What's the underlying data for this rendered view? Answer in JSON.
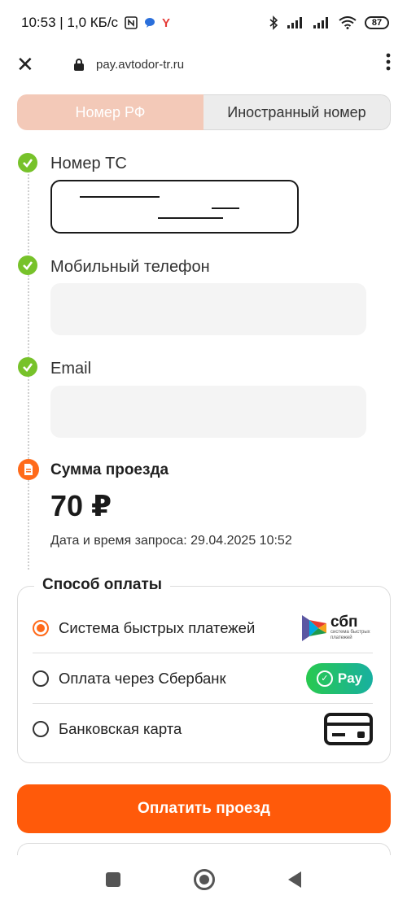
{
  "status_bar": {
    "time_speed": "10:53 | 1,0 КБ/с",
    "battery": "87"
  },
  "browser": {
    "url": "pay.avtodor-tr.ru"
  },
  "tabs": [
    {
      "label": "Номер РФ",
      "active": true
    },
    {
      "label": "Иностранный номер",
      "active": false
    }
  ],
  "form": {
    "vehicle_label": "Номер ТС",
    "phone_label": "Мобильный телефон",
    "email_label": "Email"
  },
  "summary": {
    "title": "Сумма проезда",
    "amount": "70 ₽",
    "request_date": "Дата и время запроса: 29.04.2025 10:52"
  },
  "payment": {
    "legend": "Способ оплаты",
    "options": [
      {
        "label": "Система быстрых платежей",
        "selected": true,
        "logo": "sbp-logo"
      },
      {
        "label": "Оплата через Сбербанк",
        "selected": false,
        "logo": "sberpay-logo"
      },
      {
        "label": "Банковская карта",
        "selected": false,
        "logo": "bank-card-icon"
      }
    ],
    "sbp_logo_text": "сбп",
    "sbp_logo_subtext": "система быстрых платежей",
    "sberpay_text": "Pay",
    "button_label": "Оплатить проезд"
  },
  "colors": {
    "accent": "#ff5a0a",
    "tab_active": "#f3c9b8",
    "success": "#77c22a"
  }
}
